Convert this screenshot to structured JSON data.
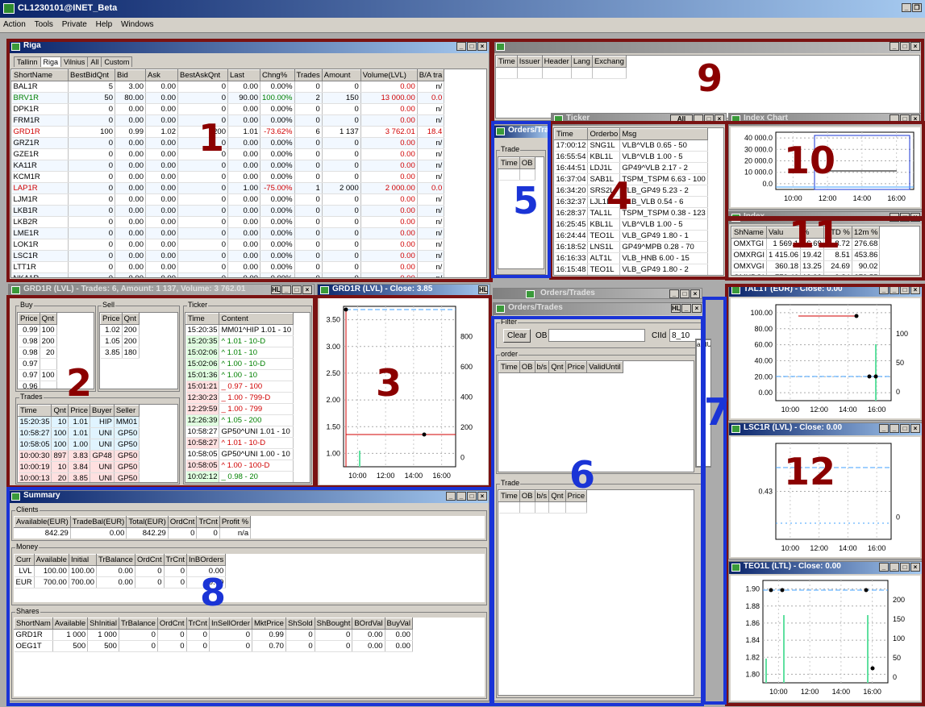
{
  "app": {
    "title": "CL1230101@INET_Beta",
    "menu": [
      "Action",
      "Tools",
      "Private",
      "Help",
      "Windows"
    ]
  },
  "riga": {
    "title": "Riga",
    "tabs": [
      "Tallinn",
      "Riga",
      "Vilnius",
      "All",
      "Custom"
    ],
    "cols": [
      "ShortName",
      "BestBidQnt",
      "Bid",
      "Ask",
      "BestAskQnt",
      "Last",
      "Chng%",
      "Trades",
      "Amount",
      "Volume(LVL)",
      "B/A tra"
    ],
    "rows": [
      [
        "BAL1R",
        "5",
        "3.00",
        "0.00",
        "0",
        "0.00",
        "0.00%",
        "0",
        "0",
        "0.00",
        "n/"
      ],
      [
        "BRV1R",
        "50",
        "80.00",
        "0.00",
        "0",
        "90.00",
        "100.00%",
        "2",
        "150",
        "13 000.00",
        "0.0"
      ],
      [
        "DPK1R",
        "0",
        "0.00",
        "0.00",
        "0",
        "0.00",
        "0.00%",
        "0",
        "0",
        "0.00",
        "n/"
      ],
      [
        "FRM1R",
        "0",
        "0.00",
        "0.00",
        "0",
        "0.00",
        "0.00%",
        "0",
        "0",
        "0.00",
        "n/"
      ],
      [
        "GRD1R",
        "100",
        "0.99",
        "1.02",
        "200",
        "1.01",
        "-73.62%",
        "6",
        "1 137",
        "3 762.01",
        "18.4"
      ],
      [
        "GRZ1R",
        "0",
        "0.00",
        "0.00",
        "0",
        "0.00",
        "0.00%",
        "0",
        "0",
        "0.00",
        "n/"
      ],
      [
        "GZE1R",
        "0",
        "0.00",
        "0.00",
        "0",
        "0.00",
        "0.00%",
        "0",
        "0",
        "0.00",
        "n/"
      ],
      [
        "KA11R",
        "0",
        "0.00",
        "0.00",
        "0",
        "0.00",
        "0.00%",
        "0",
        "0",
        "0.00",
        "n/"
      ],
      [
        "KCM1R",
        "0",
        "0.00",
        "0.00",
        "0",
        "0.00",
        "0.00%",
        "0",
        "0",
        "0.00",
        "n/"
      ],
      [
        "LAP1R",
        "0",
        "0.00",
        "0.00",
        "0",
        "1.00",
        "-75.00%",
        "1",
        "2 000",
        "2 000.00",
        "0.0"
      ],
      [
        "LJM1R",
        "0",
        "0.00",
        "0.00",
        "0",
        "0.00",
        "0.00%",
        "0",
        "0",
        "0.00",
        "n/"
      ],
      [
        "LKB1R",
        "0",
        "0.00",
        "0.00",
        "0",
        "0.00",
        "0.00%",
        "0",
        "0",
        "0.00",
        "n/"
      ],
      [
        "LKB2R",
        "0",
        "0.00",
        "0.00",
        "0",
        "0.00",
        "0.00%",
        "0",
        "0",
        "0.00",
        "n/"
      ],
      [
        "LME1R",
        "0",
        "0.00",
        "0.00",
        "0",
        "0.00",
        "0.00%",
        "0",
        "0",
        "0.00",
        "n/"
      ],
      [
        "LOK1R",
        "0",
        "0.00",
        "0.00",
        "0",
        "0.00",
        "0.00%",
        "0",
        "0",
        "0.00",
        "n/"
      ],
      [
        "LSC1R",
        "0",
        "0.00",
        "0.00",
        "0",
        "0.00",
        "0.00%",
        "0",
        "0",
        "0.00",
        "n/"
      ],
      [
        "LTT1R",
        "0",
        "0.00",
        "0.00",
        "0",
        "0.00",
        "0.00%",
        "0",
        "0",
        "0.00",
        "n/"
      ],
      [
        "NKA1R",
        "0",
        "0.00",
        "0.00",
        "0",
        "0.00",
        "0.00%",
        "0",
        "0",
        "0.00",
        "n/"
      ]
    ]
  },
  "news": {
    "cols": [
      "Time",
      "Issuer",
      "Header",
      "Lang",
      "Exchang"
    ]
  },
  "ticker": {
    "title": "Ticker",
    "filter": "All",
    "cols": [
      "Time",
      "Orderbo",
      "Msg"
    ],
    "rows": [
      [
        "17:00:12",
        "SNG1L",
        "VLB^VLB  0.65 - 50"
      ],
      [
        "16:55:54",
        "KBL1L",
        "VLB^VLB  1.00 - 5"
      ],
      [
        "16:44:51",
        "LDJ1L",
        "GP49^VLB  2.17 - 2"
      ],
      [
        "16:37:04",
        "SAB1L",
        "TSPM_TSPM  6.63 - 100"
      ],
      [
        "16:34:20",
        "SRS2L",
        "VLB_GP49  5.23 - 2"
      ],
      [
        "16:32:37",
        "LJL1L",
        "VLB_VLB  0.54 - 6"
      ],
      [
        "16:28:37",
        "TAL1L",
        "TSPM_TSPM  0.38 - 123"
      ],
      [
        "16:25:45",
        "KBL1L",
        "VLB^VLB  1.00 - 5"
      ],
      [
        "16:24:44",
        "TEO1L",
        "VLB_GP49  1.80 - 1"
      ],
      [
        "16:18:52",
        "LNS1L",
        "GP49^MPB  0.28 - 70"
      ],
      [
        "16:16:33",
        "ALT1L",
        "VLB_HNB  6.00 - 15"
      ],
      [
        "16:15:48",
        "TEO1L",
        "VLB_GP49  1.80 - 2"
      ],
      [
        "16:05:15",
        "TEO1L",
        "GP49^VLB  1.80 - 15"
      ]
    ]
  },
  "ordersSmall": {
    "title": "Orders/Trades",
    "group": "Trade",
    "cols": [
      "Time",
      "OB"
    ]
  },
  "indexChart": {
    "title": "Index Chart",
    "yticks": [
      "40 000.0",
      "30 000.0",
      "20 000.0",
      "10 000.0",
      "0.0"
    ],
    "xticks": [
      "10:00",
      "12:00",
      "14:00",
      "16:00"
    ]
  },
  "index": {
    "title": "Index",
    "cols": [
      "ShName",
      "Valu",
      "%",
      "YTD %",
      "12m %"
    ],
    "rows": [
      [
        "OMXTGI",
        "1 569.1",
        "6.69",
        "-8.72",
        "276.68"
      ],
      [
        "OMXRGI",
        "1 415.06",
        "19.42",
        "8.51",
        "453.86"
      ],
      [
        "OMXVGI",
        "360.18",
        "13.25",
        "24.69",
        "90.02"
      ],
      [
        "OMXBGI",
        "772.46",
        "13.93",
        "9.84",
        "278.55"
      ]
    ]
  },
  "grd": {
    "title": "GRD1R (LVL) - Trades: 6, Amount: 1 137, Volume: 3 762.01",
    "hl": "HL",
    "buy": "Buy",
    "sell": "Sell",
    "bookCols": [
      "Price",
      "Qnt"
    ],
    "buyRows": [
      [
        "0.99",
        "100"
      ],
      [
        "0.98",
        "200"
      ],
      [
        "0.98",
        "20"
      ],
      [
        "0.97",
        ""
      ],
      [
        "0.97",
        "100"
      ],
      [
        "0.96",
        ""
      ]
    ],
    "sellRows": [
      [
        "1.02",
        "200"
      ],
      [
        "1.05",
        "200"
      ],
      [
        "3.85",
        "180"
      ]
    ],
    "trades": "Trades",
    "tradeCols": [
      "Time",
      "Qnt",
      "Price",
      "Buyer",
      "Seller"
    ],
    "tradeRows": [
      [
        "15:20:35",
        "10",
        "1.01",
        "HIP",
        "MM01"
      ],
      [
        "10:58:27",
        "100",
        "1.01",
        "UNI",
        "GP50"
      ],
      [
        "10:58:05",
        "100",
        "1.00",
        "UNI",
        "GP50"
      ],
      [
        "10:00:30",
        "897",
        "3.83",
        "GP48",
        "GP50"
      ],
      [
        "10:00:19",
        "10",
        "3.84",
        "UNI",
        "GP50"
      ],
      [
        "10:00:13",
        "20",
        "3.85",
        "UNI",
        "GP50"
      ]
    ],
    "tickerGrp": "Ticker",
    "tickerCols": [
      "Time",
      "Content"
    ],
    "tickerRows": [
      [
        "15:20:35",
        "MM01^HIP  1.01 - 10",
        "n"
      ],
      [
        "15:20:35",
        "^ 1.01 - 10-D",
        "g"
      ],
      [
        "15:02:06",
        "^ 1.01 - 10",
        "g"
      ],
      [
        "15:02:06",
        "^ 1.00 - 10-D",
        "g"
      ],
      [
        "15:01:36",
        "^ 1.00 - 10",
        "g"
      ],
      [
        "15:01:21",
        "_ 0.97 - 100",
        "r"
      ],
      [
        "12:30:23",
        "_ 1.00 - 799-D",
        "r"
      ],
      [
        "12:29:59",
        "_ 1.00 - 799",
        "r"
      ],
      [
        "12:26:39",
        "^ 1.05 - 200",
        "g"
      ],
      [
        "10:58:27",
        "GP50^UNI  1.01 - 10",
        "n"
      ],
      [
        "10:58:27",
        "^ 1.01 - 10-D",
        "r"
      ],
      [
        "10:58:05",
        "GP50^UNI  1.00 - 10",
        "n"
      ],
      [
        "10:58:05",
        "^ 1.00 - 100-D",
        "r"
      ],
      [
        "10:02:12",
        "_ 0.98 - 20",
        "g"
      ]
    ]
  },
  "grdChart": {
    "title": "GRD1R (LVL) - Close: 3.85",
    "hl": "HL",
    "yticks": [
      "3.50",
      "3.00",
      "2.50",
      "2.00",
      "1.50",
      "1.00"
    ],
    "y2ticks": [
      "800",
      "600",
      "400",
      "200",
      "0"
    ],
    "xticks": [
      "10:00",
      "12:00",
      "14:00",
      "16:00"
    ]
  },
  "ot": {
    "title": "Orders/Trades",
    "back": "Orders/Trades",
    "hl": "HL",
    "filter": "Filter",
    "clear": "Clear",
    "ob": "OB",
    "clid": "CIId",
    "clidVal": "8_10",
    "order": "order",
    "orderCols": [
      "Time",
      "OB",
      "b/s",
      "Qnt",
      "Price",
      "ValidUntil"
    ],
    "trade": "Trade",
    "tradeCols": [
      "Time",
      "OB",
      "b/s",
      "Qnt",
      "Price"
    ],
    "sideCol": "alidUntil"
  },
  "summary": {
    "title": "Summary",
    "clients": "Clients",
    "clientCols": [
      "Available(EUR)",
      "TradeBal(EUR)",
      "Total(EUR)",
      "OrdCnt",
      "TrCnt",
      "Profit %"
    ],
    "clientRow": [
      "842.29",
      "0.00",
      "842.29",
      "0",
      "0",
      "n/a"
    ],
    "money": "Money",
    "moneyCols": [
      "Curr",
      "Available",
      "Initial",
      "TrBalance",
      "OrdCnt",
      "TrCnt",
      "InBOrders"
    ],
    "moneyRows": [
      [
        "LVL",
        "100.00",
        "100.00",
        "0.00",
        "0",
        "0",
        "0.00"
      ],
      [
        "EUR",
        "700.00",
        "700.00",
        "0.00",
        "0",
        "0",
        "0.00"
      ]
    ],
    "shares": "Shares",
    "shareCols": [
      "ShortNam",
      "Available",
      "ShInitial",
      "TrBalance",
      "OrdCnt",
      "TrCnt",
      "InSellOrder",
      "MktPrice",
      "ShSold",
      "ShBought",
      "BOrdVal",
      "BuyVal"
    ],
    "shareRows": [
      [
        "GRD1R",
        "1 000",
        "1 000",
        "0",
        "0",
        "0",
        "0",
        "0.99",
        "0",
        "0",
        "0.00",
        "0.00"
      ],
      [
        "OEG1T",
        "500",
        "500",
        "0",
        "0",
        "0",
        "0",
        "0.70",
        "0",
        "0",
        "0.00",
        "0.00"
      ]
    ]
  },
  "tal": {
    "title": "TAL1T (EUR) - Close: 0.00",
    "yticks": [
      "100.00",
      "80.00",
      "60.00",
      "40.00",
      "20.00",
      "0.00"
    ],
    "y2ticks": [
      "100",
      "50",
      "0"
    ],
    "xticks": [
      "10:00",
      "12:00",
      "14:00",
      "16:00"
    ]
  },
  "lsc": {
    "title": "LSC1R (LVL) - Close: 0.00",
    "ytick": "0.43",
    "y2tick": "0",
    "xticks": [
      "10:00",
      "12:00",
      "14:00",
      "16:00"
    ]
  },
  "teo": {
    "title": "TEO1L (LTL) - Close: 0.00",
    "yticks": [
      "1.90",
      "1.88",
      "1.86",
      "1.84",
      "1.82",
      "1.80"
    ],
    "y2ticks": [
      "200",
      "150",
      "100",
      "50",
      "0"
    ],
    "xticks": [
      "10:00",
      "12:00",
      "14:00",
      "16:00"
    ]
  },
  "labels": [
    "1",
    "2",
    "3",
    "4",
    "5",
    "6",
    "7",
    "8",
    "9",
    "10",
    "11",
    "12"
  ],
  "colors": {
    "red": "#7a1212",
    "blue": "#1a34d6"
  }
}
